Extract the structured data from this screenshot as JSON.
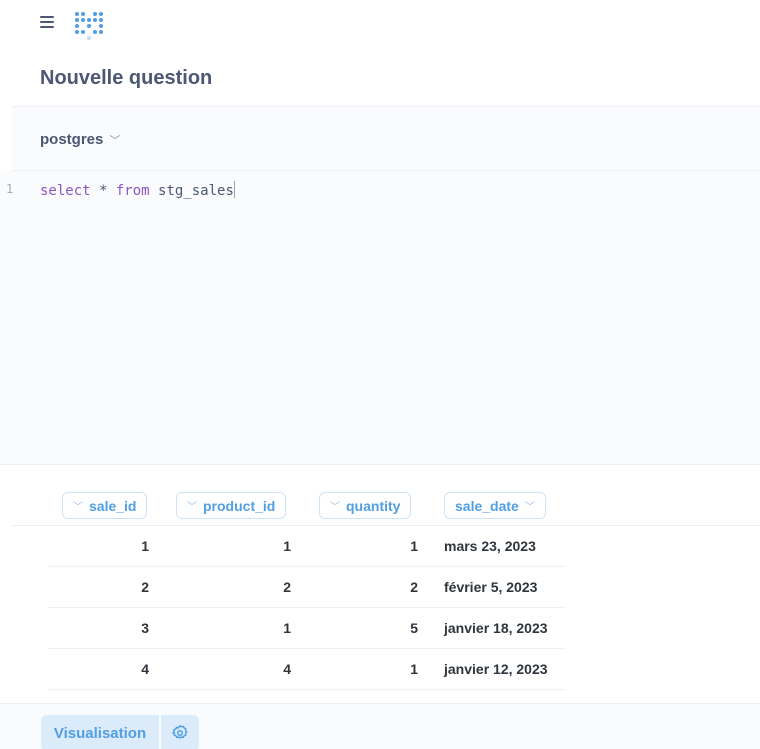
{
  "nav": {
    "menu_icon": "hamburger-icon",
    "logo_icon": "metabase-logo-icon"
  },
  "page_title": "Nouvelle question",
  "database": {
    "selected": "postgres",
    "chevron_icon": "chevron-down-icon"
  },
  "editor": {
    "line_number": "1",
    "keyword_select": "select",
    "star": " * ",
    "keyword_from": "from",
    "table": " stg_sales"
  },
  "table": {
    "columns": [
      {
        "label": "sale_id",
        "chevron": "chevron-down-icon"
      },
      {
        "label": "product_id",
        "chevron": "chevron-down-icon"
      },
      {
        "label": "quantity",
        "chevron": "chevron-down-icon"
      },
      {
        "label": "sale_date",
        "chevron": "chevron-down-icon"
      }
    ],
    "rows": [
      [
        "1",
        "1",
        "1",
        "mars 23, 2023"
      ],
      [
        "2",
        "2",
        "2",
        "février 5, 2023"
      ],
      [
        "3",
        "1",
        "5",
        "janvier 18, 2023"
      ],
      [
        "4",
        "4",
        "1",
        "janvier 12, 2023"
      ]
    ]
  },
  "footer": {
    "visualization_label": "Visualisation",
    "settings_icon": "gear-icon"
  },
  "colors": {
    "brand": "#509ee3",
    "keyword": "#8b57c2",
    "text": "#2e353b",
    "title": "#4c5773"
  }
}
